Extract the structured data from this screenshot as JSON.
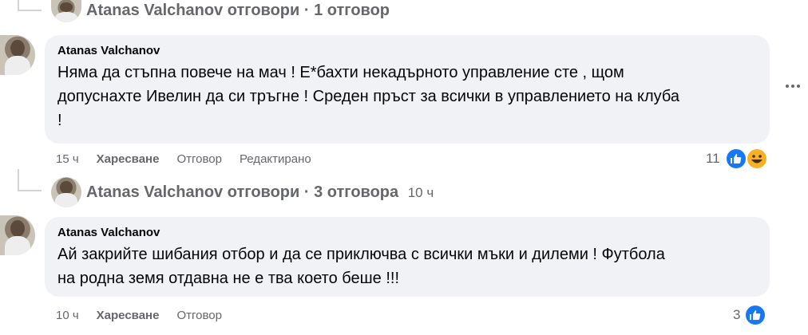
{
  "thread": {
    "top_reply_link": {
      "author": "Atanas Valchanov",
      "text": "отговори · 1 отговор"
    },
    "mid_reply_link": {
      "author": "Atanas Valchanov",
      "text": "отговори · 3 отговора",
      "time": "10 ч"
    }
  },
  "comments": [
    {
      "author": "Atanas Valchanov",
      "lines": [
        "Няма да стъпна повече на мач ! Е*бахти некадърното управление сте , щом",
        "допуснахте Ивелин да си тръгне ! Среден пръст за всички в управлението на клуба",
        "!"
      ],
      "time": "15 ч",
      "like_label": "Харесване",
      "reply_label": "Отговор",
      "edited_label": "Редактирано",
      "reaction_count": "11",
      "reactions": [
        "like-icon",
        "haha-icon"
      ]
    },
    {
      "author": "Atanas Valchanov",
      "lines": [
        "Ай закрийте шибания отбор и да се приключва с всички мъки и дилеми ! Футбола",
        "на родна земя отдавна не е тва което беше !!!"
      ],
      "time": "10 ч",
      "like_label": "Харесване",
      "reply_label": "Отговор",
      "reaction_count": "3",
      "reactions": [
        "like-icon"
      ]
    }
  ],
  "colors": {
    "bubble": "#f0f2f5",
    "secondary_text": "#65676b",
    "like": "#1877f2",
    "haha": "#f7b125"
  }
}
